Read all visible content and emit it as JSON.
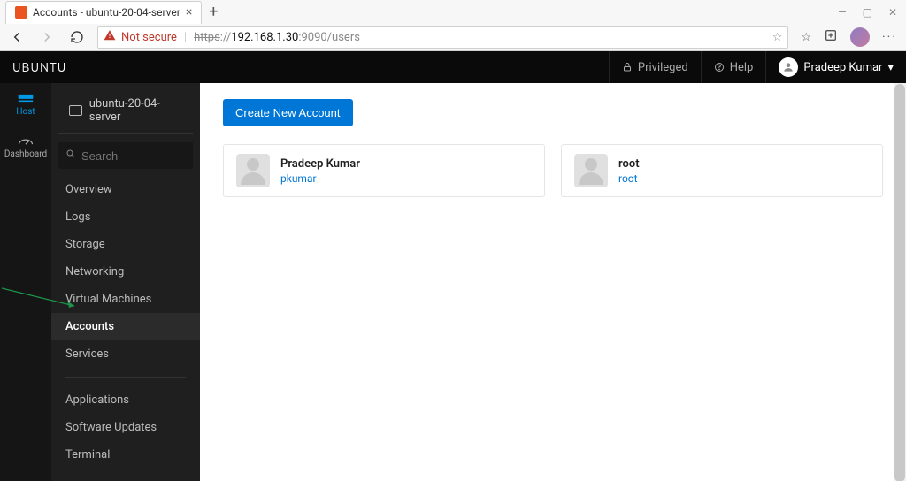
{
  "browser": {
    "tab_title": "Accounts - ubuntu-20-04-server",
    "not_secure_label": "Not secure",
    "url": {
      "https": "https",
      "sep": "://",
      "host": "192.168.1.30",
      "port_path": ":9090/users"
    }
  },
  "header": {
    "brand": "UBUNTU",
    "privileged": "Privileged",
    "help": "Help",
    "user_name": "Pradeep Kumar"
  },
  "rail": {
    "host": "Host",
    "dashboard": "Dashboard"
  },
  "sidebar": {
    "host_name": "ubuntu-20-04-server",
    "search_placeholder": "Search",
    "items": [
      "Overview",
      "Logs",
      "Storage",
      "Networking",
      "Virtual Machines",
      "Accounts",
      "Services"
    ],
    "active_index": 5,
    "items_secondary": [
      "Applications",
      "Software Updates",
      "Terminal"
    ]
  },
  "content": {
    "create_button": "Create New Account",
    "accounts": [
      {
        "name": "Pradeep Kumar",
        "user": "pkumar"
      },
      {
        "name": "root",
        "user": "root"
      }
    ]
  }
}
